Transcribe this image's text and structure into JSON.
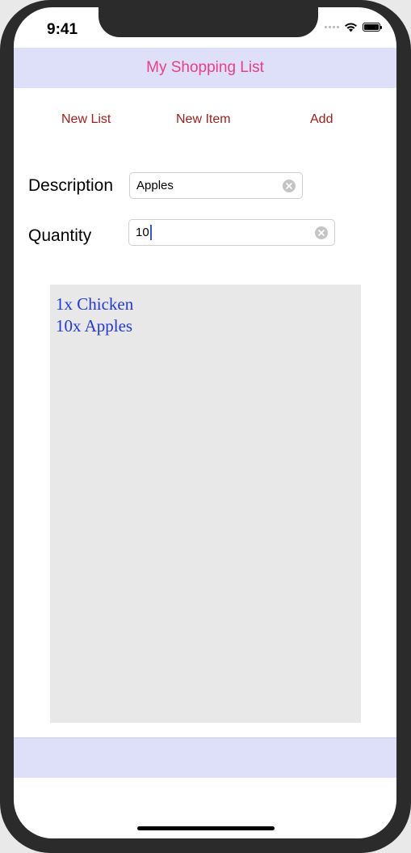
{
  "status_bar": {
    "time": "9:41",
    "icons": [
      "signal-icon",
      "wifi-icon",
      "battery-icon"
    ]
  },
  "nav": {
    "title": "My Shopping List",
    "title_color": "#ea3e86",
    "background": "#dde0f8"
  },
  "toolbar": {
    "new_list_label": "New List",
    "new_item_label": "New Item",
    "add_label": "Add",
    "button_color": "#a0201c"
  },
  "form": {
    "description_label": "Description",
    "description_value": "Apples",
    "quantity_label": "Quantity",
    "quantity_value": "10"
  },
  "shopping_list": {
    "items": [
      "1x Chicken",
      "10x Apples"
    ],
    "text_color": "#2238de",
    "background": "#e8e8e8"
  }
}
